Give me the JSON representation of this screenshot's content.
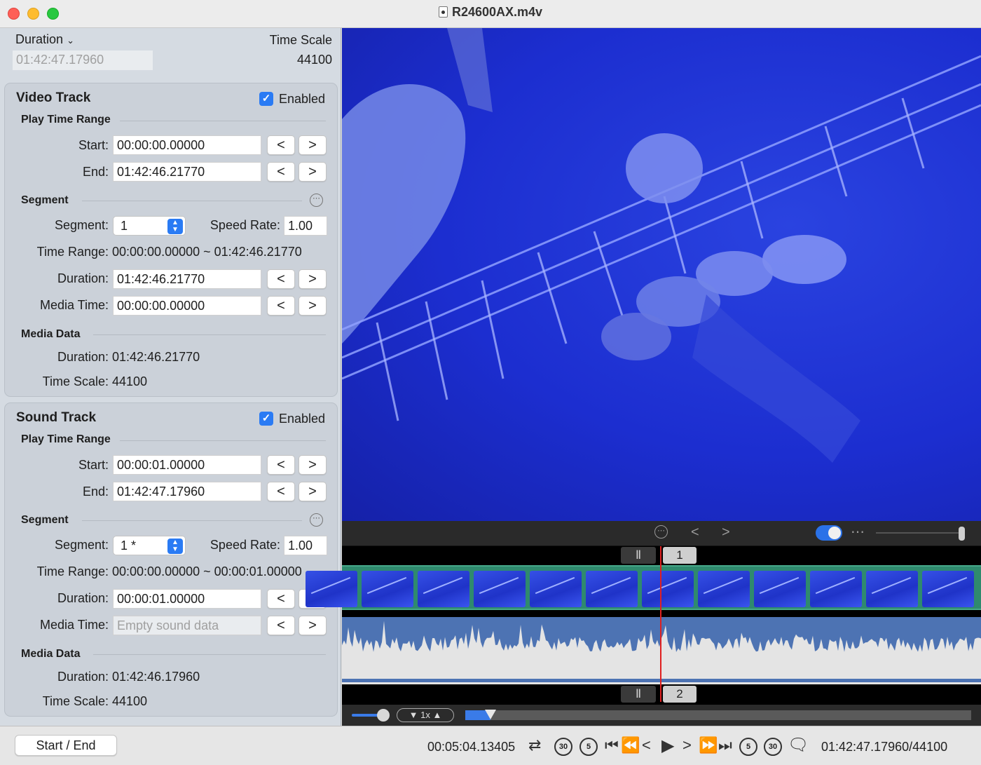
{
  "window": {
    "title": "R24600AX.m4v"
  },
  "header": {
    "duration_label": "Duration",
    "duration_value": "01:42:47.17960",
    "timescale_label": "Time Scale",
    "timescale_value": "44100"
  },
  "video_track": {
    "title": "Video Track",
    "enabled_label": "Enabled",
    "enabled": true,
    "play_time_range": "Play Time Range",
    "start_label": "Start:",
    "start_value": "00:00:00.00000",
    "end_label": "End:",
    "end_value": "01:42:46.21770",
    "segment_heading": "Segment",
    "segment_label": "Segment:",
    "segment_value": "1",
    "speed_label": "Speed Rate:",
    "speed_value": "1.00",
    "time_range_label": "Time Range:",
    "time_range_value": "00:00:00.00000 ~ 01:42:46.21770",
    "duration_label": "Duration:",
    "duration_value": "01:42:46.21770",
    "media_time_label": "Media Time:",
    "media_time_value": "00:00:00.00000",
    "media_data_heading": "Media Data",
    "md_duration_label": "Duration:",
    "md_duration_value": "01:42:46.21770",
    "md_timescale_label": "Time Scale:",
    "md_timescale_value": "44100"
  },
  "sound_track": {
    "title": "Sound Track",
    "enabled_label": "Enabled",
    "enabled": true,
    "play_time_range": "Play Time Range",
    "start_label": "Start:",
    "start_value": "00:00:01.00000",
    "end_label": "End:",
    "end_value": "01:42:47.17960",
    "segment_heading": "Segment",
    "segment_label": "Segment:",
    "segment_value": "1 *",
    "speed_label": "Speed Rate:",
    "speed_value": "1.00",
    "time_range_label": "Time Range:",
    "time_range_value": "00:00:00.00000 ~ 00:00:01.00000",
    "duration_label": "Duration:",
    "duration_value": "00:00:01.00000",
    "media_time_label": "Media Time:",
    "media_time_placeholder": "Empty sound data",
    "media_data_heading": "Media Data",
    "md_duration_label": "Duration:",
    "md_duration_value": "01:42:46.17960",
    "md_timescale_label": "Time Scale:",
    "md_timescale_value": "44100"
  },
  "nav": {
    "prev_glyph": "<",
    "next_glyph": ">"
  },
  "timeline": {
    "video_segment_number": "1",
    "sound_segment_number": "2",
    "rate_label": "1x",
    "playback_progress": 0.05
  },
  "bottom": {
    "start_end_button": "Start / End",
    "current_time": "00:05:04.13405",
    "total_time": "01:42:47.17960/44100",
    "skip_back_30": "30",
    "skip_back_5": "5",
    "skip_fwd_5": "5",
    "skip_fwd_30": "30"
  },
  "colors": {
    "accent": "#2a7bf4",
    "video_bg": "#1c2ed0",
    "filmstrip": "#2f8a6e",
    "waveform": "#4d73b3",
    "playhead": "#e02020"
  }
}
